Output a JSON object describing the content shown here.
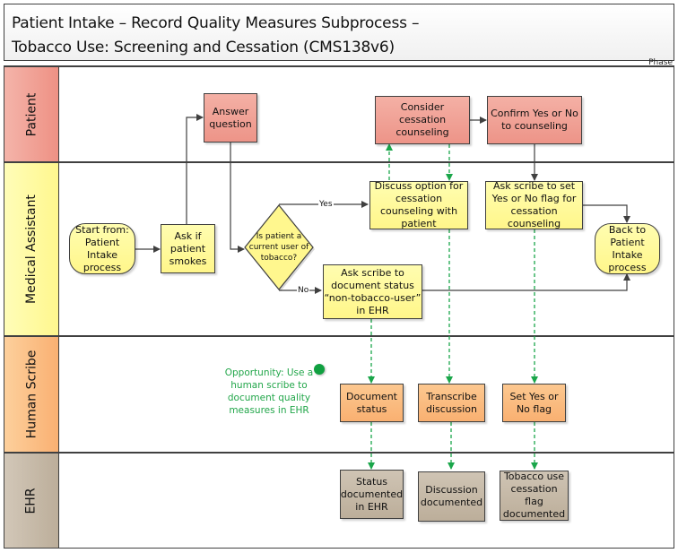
{
  "title": {
    "line1": "Patient Intake – Record Quality Measures Subprocess –",
    "line2": "Tobacco Use: Screening and Cessation (CMS138v6)"
  },
  "phase_label": "Phase",
  "lanes": [
    {
      "id": "patient",
      "label": "Patient",
      "color": "#f09c90"
    },
    {
      "id": "medical-assistant",
      "label": "Medical Assistant",
      "color": "#fff98f"
    },
    {
      "id": "human-scribe",
      "label": "Human Scribe",
      "color": "#fbb878"
    },
    {
      "id": "ehr",
      "label": "EHR",
      "color": "#c3b6a3"
    }
  ],
  "nodes": {
    "answer_question": "Answer question",
    "consider_cessation": "Consider cessation counseling",
    "confirm_yes_no": "Confirm Yes or No to counseling",
    "start": "Start from: Patient Intake process",
    "ask_if_smokes": "Ask if patient smokes",
    "decision": "Is patient a current user of tobacco?",
    "discuss_option": "Discuss option for cessation counseling with patient",
    "ask_scribe_flag": "Ask scribe to set Yes or No flag for cessation counseling",
    "ask_scribe_status": "Ask scribe to document status “non-tobacco-user” in EHR",
    "back_to_intake": "Back to Patient Intake process",
    "document_status": "Document status",
    "transcribe_discussion": "Transcribe discussion",
    "set_flag": "Set Yes or No flag",
    "status_documented": "Status documented in EHR",
    "discussion_documented": "Discussion documented",
    "flag_documented": "Tobacco use cessation flag documented"
  },
  "edge_labels": {
    "yes": "Yes",
    "no": "No"
  },
  "opportunity": {
    "text": "Opportunity: Use a human scribe to document quality measures in EHR",
    "color": "#22a64a"
  },
  "colors": {
    "line": "#404040",
    "dashed_line": "#1aa64a"
  }
}
